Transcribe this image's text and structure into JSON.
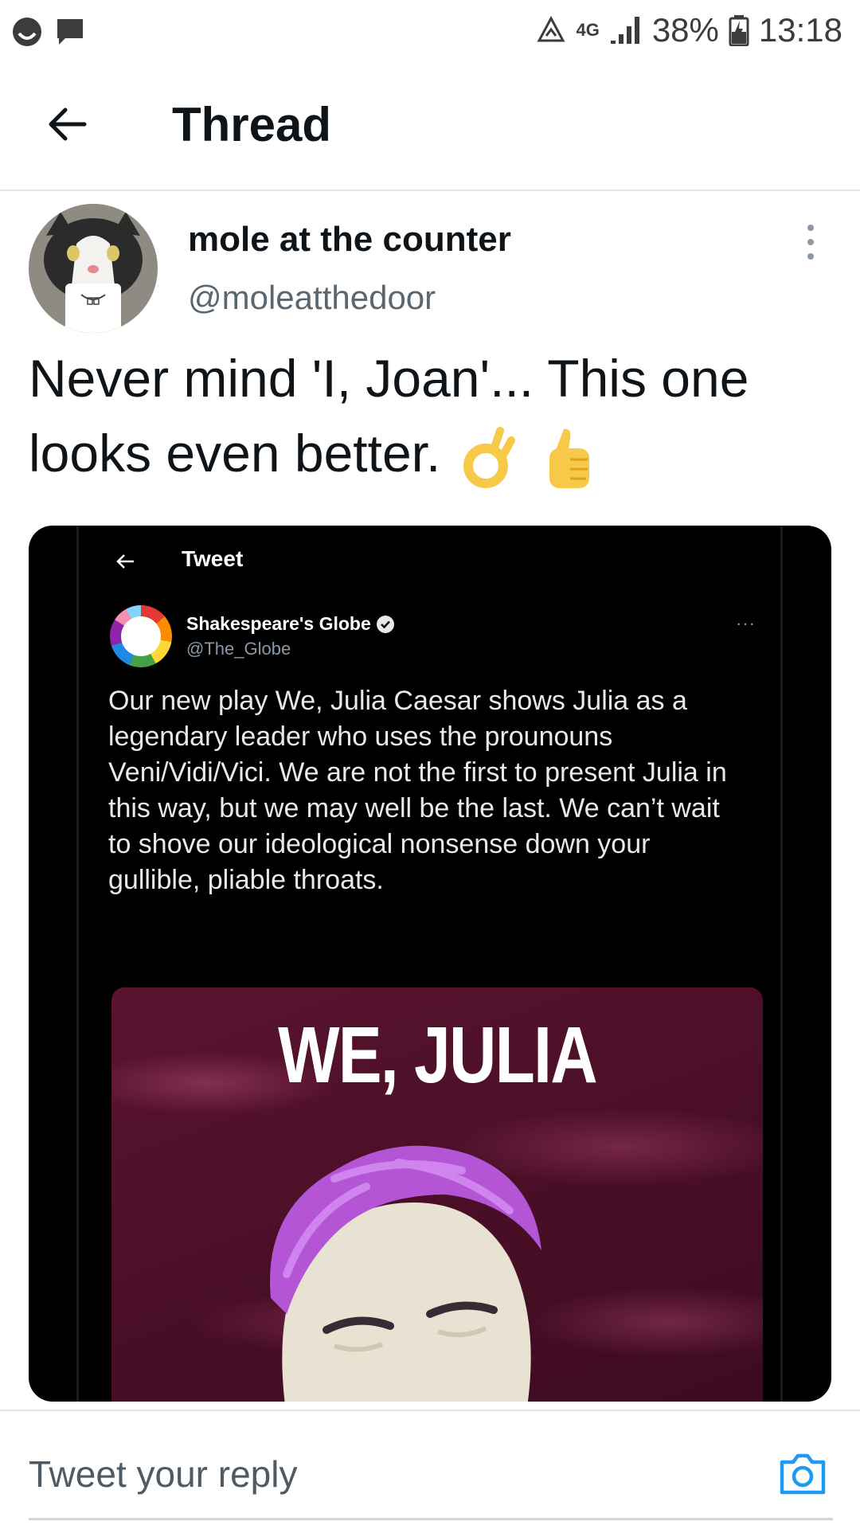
{
  "status_bar": {
    "network": "4G",
    "battery": "38%",
    "time": "13:18"
  },
  "header": {
    "title": "Thread"
  },
  "tweet": {
    "display_name": "mole at the counter",
    "handle": "@moleatthedoor",
    "text": "Never mind 'I, Joan'...  This one looks even better.",
    "emojis": [
      "ok-hand-emoji",
      "thumbs-up-emoji"
    ]
  },
  "embedded_tweet": {
    "header_title": "Tweet",
    "display_name": "Shakespeare's Globe",
    "handle": "@The_Globe",
    "more": "···",
    "text": "Our new play We, Julia Caesar shows Julia as a legendary leader who uses the prounouns Veni/Vidi/Vici. We are not the first to present Julia in this way, but we may well be the last. We can’t wait to shove our ideological nonsense down your gullible, pliable throats.",
    "poster_title": "WE, JULIA"
  },
  "reply": {
    "placeholder": "Tweet your reply"
  },
  "colors": {
    "accent": "#1d9bf0",
    "text": "#0f1419",
    "secondary": "#5b6770",
    "poster_bg": "#4a0f27"
  }
}
